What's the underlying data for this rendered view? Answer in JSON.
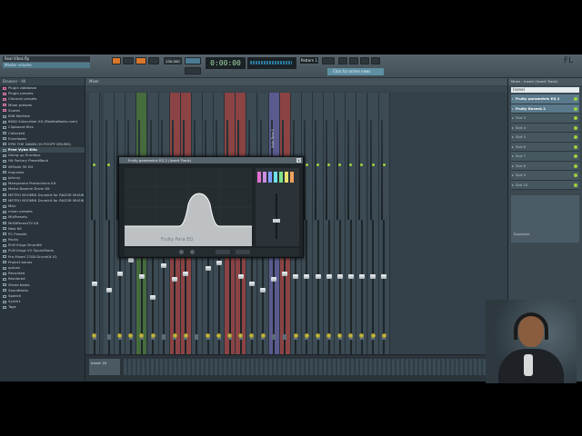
{
  "toolbar": {
    "title": "Real Vibez.flp",
    "hint": "Master volume",
    "time_display": "0:00:00",
    "tempo": "130.000",
    "pattern": "Pattern 1",
    "news_label": "Click for online news",
    "logo": "FL"
  },
  "browser": {
    "header": "Browser - All",
    "items": [
      {
        "label": "Plugin database",
        "pink": true
      },
      {
        "label": "Plugin presets",
        "pink": true
      },
      {
        "label": "Channel presets",
        "pink": true
      },
      {
        "label": "Mixer presets",
        "pink": true
      },
      {
        "label": "Scores",
        "pink": true
      },
      {
        "label": "808 Warfare",
        "pink": false
      },
      {
        "label": "6000 Subscriber Kit (PablitoBeats.com)",
        "pink": false
      },
      {
        "label": "Clipboard files",
        "pink": false
      },
      {
        "label": "Collected",
        "pink": false
      },
      {
        "label": "Envelopes",
        "pink": false
      },
      {
        "label": "EPIK THE DAWN (Hi POOPY DRUMS)",
        "pink": false
      },
      {
        "label": "Free Vybe Kits",
        "pink": false,
        "selected": true
      },
      {
        "label": "Going up Sundays",
        "pink": false
      },
      {
        "label": "Hit Factory PresetBank",
        "pink": false
      },
      {
        "label": "illMuzik 5K Kit",
        "pink": false
      },
      {
        "label": "Impulses",
        "pink": false
      },
      {
        "label": "Johnny",
        "pink": false
      },
      {
        "label": "Marquanna Productions Kit",
        "pink": false
      },
      {
        "label": "Metro Boomin Drum Kit",
        "pink": false
      },
      {
        "label": "METRO BOOMIN Drumkit for RAZOR MUSIK",
        "pink": false
      },
      {
        "label": "METRO BOOMIN Drumkit for RAZOR MUSIK",
        "pink": false
      },
      {
        "label": "Misc",
        "pink": false
      },
      {
        "label": "mixer presets",
        "pink": false
      },
      {
        "label": "MixPresets",
        "pink": false
      },
      {
        "label": "MrDifferentTV Kit",
        "pink": false
      },
      {
        "label": "New Kit",
        "pink": false
      },
      {
        "label": "PC Presets",
        "pink": false
      },
      {
        "label": "Packs",
        "pink": false
      },
      {
        "label": "PLM Kingz DrumKit",
        "pink": false
      },
      {
        "label": "PLM Kingz V2 SoundFonts",
        "pink": false
      },
      {
        "label": "Pro Mixed 2700 DrumKit V2",
        "pink": false
      },
      {
        "label": "Project bones",
        "pink": false
      },
      {
        "label": "quiues",
        "pink": false
      },
      {
        "label": "Recorded",
        "pink": false
      },
      {
        "label": "Rendered",
        "pink": false
      },
      {
        "label": "Sliced beats",
        "pink": false
      },
      {
        "label": "Soundfonts",
        "pink": false
      },
      {
        "label": "Speech",
        "pink": false
      },
      {
        "label": "Synth1",
        "pink": false
      },
      {
        "label": "Tags",
        "pink": false
      }
    ]
  },
  "mixer": {
    "header": "Mixer",
    "bottom_patch": "Insert 18",
    "strips": [
      {
        "label": "",
        "color": "#3b4a53",
        "handle": 0.55,
        "knob": true
      },
      {
        "label": "",
        "color": "#3b4a53",
        "handle": 0.5,
        "knob": false
      },
      {
        "label": "",
        "color": "#3b4a53",
        "handle": 0.62,
        "knob": true
      },
      {
        "label": "",
        "color": "#3b4a53",
        "handle": 0.72,
        "knob": true
      },
      {
        "label": "",
        "color": "#466b3c",
        "handle": 0.6,
        "knob": true
      },
      {
        "label": "",
        "color": "#3b4a53",
        "handle": 0.45,
        "knob": true
      },
      {
        "label": "",
        "color": "#3b4a53",
        "handle": 0.68,
        "knob": false
      },
      {
        "label": "",
        "color": "#8b4343",
        "handle": 0.58,
        "knob": true
      },
      {
        "label": "",
        "color": "#8b4343",
        "handle": 0.62,
        "knob": true
      },
      {
        "label": "",
        "color": "#3b4a53",
        "handle": 0.78,
        "knob": false
      },
      {
        "label": "",
        "color": "#3b4a53",
        "handle": 0.66,
        "knob": true
      },
      {
        "label": "",
        "color": "#3b4a53",
        "handle": 0.7,
        "knob": true
      },
      {
        "label": "",
        "color": "#8b4343",
        "handle": 0.8,
        "knob": true
      },
      {
        "label": "",
        "color": "#8b4343",
        "handle": 0.6,
        "knob": true
      },
      {
        "label": "",
        "color": "#3b4a53",
        "handle": 0.55,
        "knob": true
      },
      {
        "label": "",
        "color": "#3b4a53",
        "handle": 0.5,
        "knob": true
      },
      {
        "label": "Auto Tune 1",
        "color": "#5b5a8f",
        "handle": 0.58,
        "knob": false
      },
      {
        "label": "",
        "color": "#8b4343",
        "handle": 0.62,
        "knob": false
      },
      {
        "label": "",
        "color": "#3b4a53",
        "handle": 0.6,
        "knob": true
      },
      {
        "label": "",
        "color": "#3b4a53",
        "handle": 0.6,
        "knob": true
      },
      {
        "label": "",
        "color": "#3b4a53",
        "handle": 0.6,
        "knob": true
      },
      {
        "label": "",
        "color": "#3b4a53",
        "handle": 0.6,
        "knob": true
      },
      {
        "label": "",
        "color": "#3b4a53",
        "handle": 0.6,
        "knob": true
      },
      {
        "label": "",
        "color": "#3b4a53",
        "handle": 0.6,
        "knob": true
      },
      {
        "label": "",
        "color": "#3b4a53",
        "handle": 0.6,
        "knob": true
      },
      {
        "label": "",
        "color": "#3b4a53",
        "handle": 0.6,
        "knob": true
      },
      {
        "label": "",
        "color": "#3b4a53",
        "handle": 0.6,
        "knob": true
      }
    ]
  },
  "plugin": {
    "title": "Fruity parametric EQ 2 (Insert Track)",
    "close": "x",
    "name_label": "Fruity Para EQ"
  },
  "fxpanel": {
    "header": "Mixer - Insert (Insert Track)",
    "preset": "(none)",
    "slots": [
      {
        "label": "Fruity parametric EQ 2",
        "filled": true
      },
      {
        "label": "Fruity Reverb 2",
        "filled": true
      },
      {
        "label": "Slot 3",
        "filled": false
      },
      {
        "label": "Slot 4",
        "filled": false
      },
      {
        "label": "Slot 5",
        "filled": false
      },
      {
        "label": "Slot 6",
        "filled": false
      },
      {
        "label": "Slot 7",
        "filled": false
      },
      {
        "label": "Slot 8",
        "filled": false
      },
      {
        "label": "Slot 9",
        "filled": false
      },
      {
        "label": "Slot 10",
        "filled": false
      }
    ],
    "equalizer_label": "Equalizer"
  }
}
